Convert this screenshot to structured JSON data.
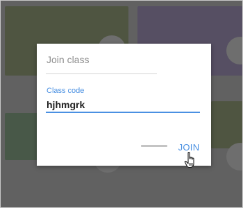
{
  "dialog": {
    "title": "Join class",
    "field_label": "Class code",
    "field_value": "hjhmgrk",
    "join_label": "JOIN"
  },
  "colors": {
    "overlay": "#616161",
    "accent": "#4a90e2",
    "card_olive": "#4f5541",
    "card_purple": "#564f63",
    "card_green": "#485848"
  },
  "icons": {
    "cursor": "hand-pointer-icon"
  }
}
